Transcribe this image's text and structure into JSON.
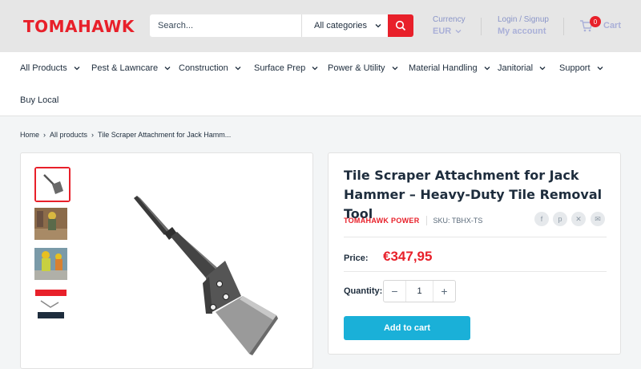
{
  "header": {
    "logo": "TOMAHAWK",
    "search_placeholder": "Search...",
    "category_select": "All categories",
    "currency_label": "Currency",
    "currency_value": "EUR",
    "account_label": "Login / Signup",
    "account_value": "My account",
    "cart_count": "0",
    "cart_label": "Cart"
  },
  "nav": {
    "items": [
      {
        "label": "All Products"
      },
      {
        "label": "Pest & Lawncare"
      },
      {
        "label": "Construction"
      },
      {
        "label": "Surface Prep"
      },
      {
        "label": "Power & Utility"
      },
      {
        "label": "Material Handling"
      },
      {
        "label": "Janitorial"
      },
      {
        "label": "Support"
      },
      {
        "label": "Buy Local"
      }
    ]
  },
  "breadcrumb": {
    "home": "Home",
    "all": "All products",
    "current": "Tile Scraper Attachment for Jack Hamm..."
  },
  "product": {
    "title": "Tile Scraper Attachment for Jack Hammer – Heavy-Duty Tile Removal Tool",
    "vendor": "TOMAHAWK POWER",
    "sku": "SKU: TBHX-TS",
    "price_label": "Price:",
    "price": "€347,95",
    "quantity_label": "Quantity:",
    "quantity": "1",
    "add_to_cart": "Add to cart",
    "thumb_poster_text": "SPARE PARTS and ACCESSORIES"
  },
  "colors": {
    "brand_red": "#e8202a",
    "button_blue": "#1ab0d8"
  }
}
